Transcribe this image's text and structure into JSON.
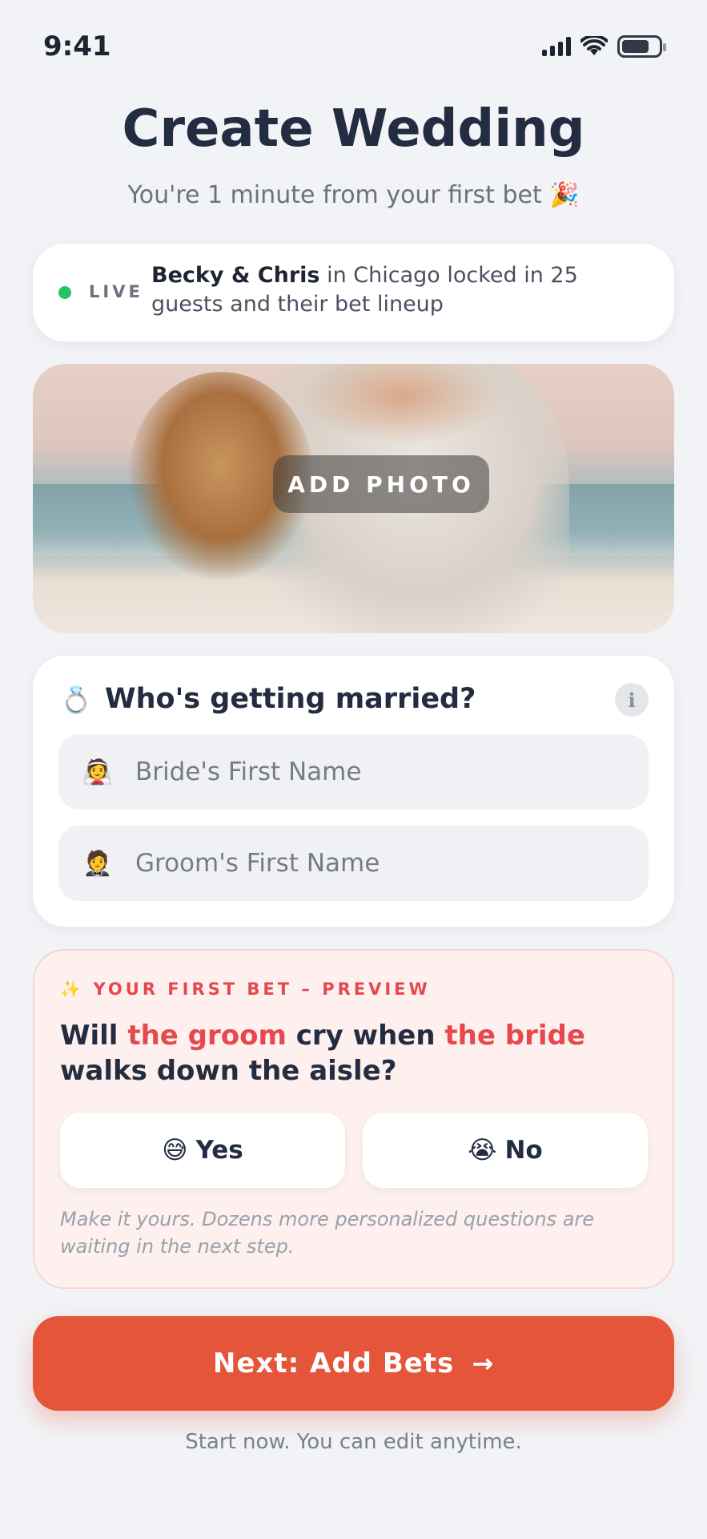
{
  "status_bar": {
    "time": "9:41",
    "icons": [
      "signal-icon",
      "wifi-icon",
      "battery-icon"
    ]
  },
  "header": {
    "title": "Create Wedding",
    "subtitle": "You're 1 minute from your first bet 🎉"
  },
  "live_banner": {
    "label": "LIVE",
    "couple": "Becky & Chris",
    "message": " in Chicago locked in 25 guests and their bet lineup",
    "dot_color": "#22c55e"
  },
  "photo": {
    "button_label": "ADD PHOTO"
  },
  "names_section": {
    "icon": "💍",
    "title": "Who's getting married?",
    "info_icon": "i",
    "bride_icon": "👰",
    "bride_placeholder": "Bride's First Name",
    "bride_value": "",
    "groom_icon": "🤵",
    "groom_placeholder": "Groom's First Name",
    "groom_value": ""
  },
  "bet_preview": {
    "kicker": "✨ YOUR FIRST BET – PREVIEW",
    "question_parts": {
      "p1": "Will ",
      "h1": "the groom",
      "p2": " cry when ",
      "h2": "the bride",
      "p3": " walks down the aisle?"
    },
    "yes_emoji": "😅",
    "yes_label": "Yes",
    "no_emoji": "😭",
    "no_label": "No",
    "note": "Make it yours. Dozens more personalized questions are waiting in the next step.",
    "accent_color": "#e5484d"
  },
  "cta": {
    "label": "Next: Add Bets",
    "arrow": "→",
    "color": "#e4553a"
  },
  "footnote": "Start now. You can edit anytime."
}
